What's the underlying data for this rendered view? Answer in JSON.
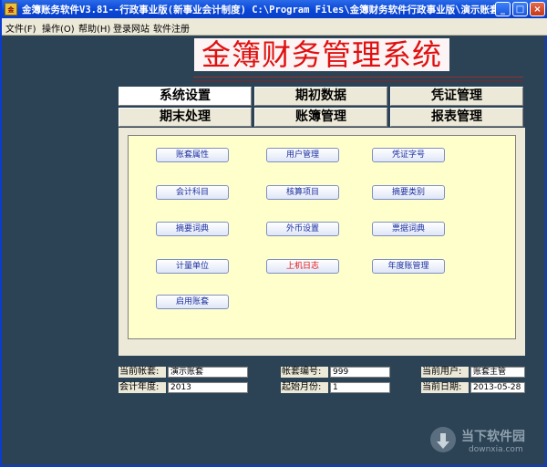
{
  "titlebar": {
    "title": "金簿账务软件V3.81--行政事业版(新事业会计制度)   C:\\Program Files\\金簿财务软件行政事业版\\演示账套",
    "minimize": "_",
    "maximize": "□",
    "close": "×"
  },
  "menu": [
    "文件(F)",
    "操作(O)",
    "帮助(H)",
    "登录网站",
    "软件注册"
  ],
  "app_title": "金簿财务管理系统",
  "tabs": [
    "系统设置",
    "期初数据",
    "凭证管理",
    "期末处理",
    "账簿管理",
    "报表管理"
  ],
  "functions": {
    "account_set_props": "账套属性",
    "user_management": "用户管理",
    "voucher_types": "凭证字号",
    "accounting_subjects": "会计科目",
    "checking_items": "核算项目",
    "summary_categories": "摘要类别",
    "summary_dictionary": "摘要词典",
    "foreign_currency": "外币设置",
    "bill_dictionary": "票据词典",
    "measure_units": "计量单位",
    "login_log": "上机日志",
    "annual_account": "年度账管理",
    "enable_account": "启用账套"
  },
  "info": {
    "current_set_label": "当前帐套:",
    "current_set_value": "演示账套",
    "set_number_label": "帐套编号:",
    "set_number_value": "999",
    "current_user_label": "当前用户:",
    "current_user_value": "账套主管",
    "fiscal_year_label": "会计年度:",
    "fiscal_year_value": "2013",
    "start_month_label": "起始月份:",
    "start_month_value": "1",
    "current_date_label": "当前日期:",
    "current_date_value": "2013-05-28"
  },
  "watermark": {
    "name": "当下软件园",
    "url": "downxia.com"
  },
  "colors": {
    "background": "#2b4355",
    "titlebar": "#0a46d8",
    "app_title_red": "#e01010",
    "panel_yellow": "#ffffcc"
  }
}
